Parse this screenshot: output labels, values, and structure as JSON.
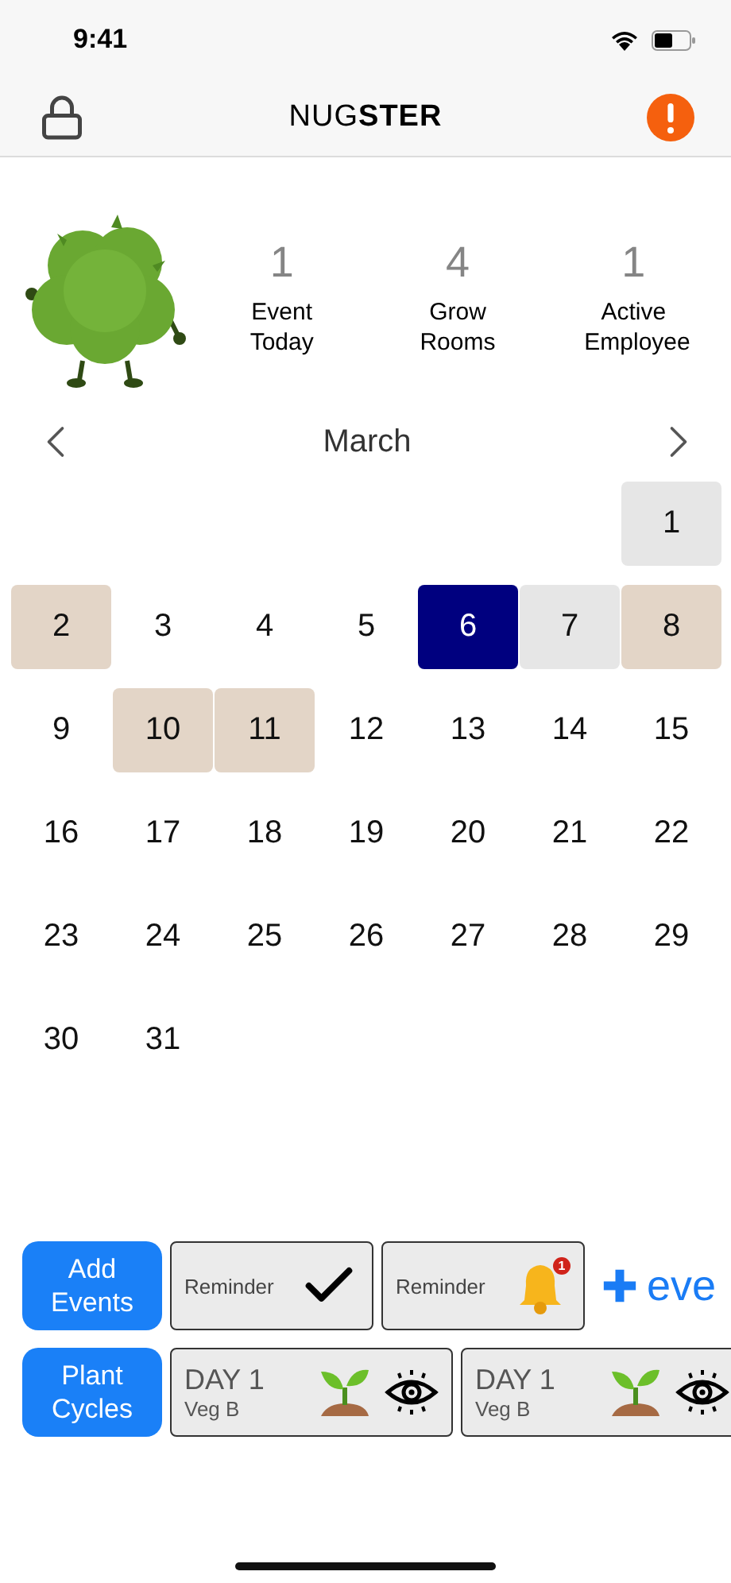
{
  "status_bar": {
    "time": "9:41"
  },
  "nav": {
    "title": "NUG**STER**"
  },
  "stats": [
    {
      "value": "1",
      "label": "Event Today"
    },
    {
      "value": "4",
      "label": "Grow Rooms"
    },
    {
      "value": "1",
      "label": "Active Employee"
    }
  ],
  "calendar": {
    "month": "March",
    "weeks": [
      [
        {
          "kind": "blank"
        },
        {
          "kind": "blank"
        },
        {
          "kind": "blank"
        },
        {
          "kind": "blank"
        },
        {
          "kind": "blank"
        },
        {
          "kind": "blank"
        },
        {
          "kind": "day",
          "label": "1",
          "selected": false,
          "has_event": false,
          "greyed": true
        }
      ],
      [
        {
          "kind": "day",
          "label": "2",
          "selected": false,
          "has_event": true,
          "greyed": false
        },
        {
          "kind": "day",
          "label": "3",
          "selected": false,
          "has_event": false,
          "greyed": false
        },
        {
          "kind": "day",
          "label": "4",
          "selected": false,
          "has_event": false,
          "greyed": false
        },
        {
          "kind": "day",
          "label": "5",
          "selected": false,
          "has_event": false,
          "greyed": false
        },
        {
          "kind": "day",
          "label": "6",
          "selected": true,
          "has_event": false,
          "greyed": false
        },
        {
          "kind": "day",
          "label": "7",
          "selected": false,
          "has_event": false,
          "greyed": true
        },
        {
          "kind": "day",
          "label": "8",
          "selected": false,
          "has_event": true,
          "greyed": false
        }
      ],
      [
        {
          "kind": "day",
          "label": "9",
          "selected": false,
          "has_event": false,
          "greyed": false
        },
        {
          "kind": "day",
          "label": "10",
          "selected": false,
          "has_event": true,
          "greyed": false
        },
        {
          "kind": "day",
          "label": "11",
          "selected": false,
          "has_event": true,
          "greyed": false
        },
        {
          "kind": "day",
          "label": "12",
          "selected": false,
          "has_event": false,
          "greyed": false
        },
        {
          "kind": "day",
          "label": "13",
          "selected": false,
          "has_event": false,
          "greyed": false
        },
        {
          "kind": "day",
          "label": "14",
          "selected": false,
          "has_event": false,
          "greyed": false
        },
        {
          "kind": "day",
          "label": "15",
          "selected": false,
          "has_event": false,
          "greyed": false
        }
      ],
      [
        {
          "kind": "day",
          "label": "16",
          "selected": false,
          "has_event": false,
          "greyed": false
        },
        {
          "kind": "day",
          "label": "17",
          "selected": false,
          "has_event": false,
          "greyed": false
        },
        {
          "kind": "day",
          "label": "18",
          "selected": false,
          "has_event": false,
          "greyed": false
        },
        {
          "kind": "day",
          "label": "19",
          "selected": false,
          "has_event": false,
          "greyed": false
        },
        {
          "kind": "day",
          "label": "20",
          "selected": false,
          "has_event": false,
          "greyed": false
        },
        {
          "kind": "day",
          "label": "21",
          "selected": false,
          "has_event": false,
          "greyed": false
        },
        {
          "kind": "day",
          "label": "22",
          "selected": false,
          "has_event": false,
          "greyed": false
        }
      ],
      [
        {
          "kind": "day",
          "label": "23",
          "selected": false,
          "has_event": false,
          "greyed": false
        },
        {
          "kind": "day",
          "label": "24",
          "selected": false,
          "has_event": false,
          "greyed": false
        },
        {
          "kind": "day",
          "label": "25",
          "selected": false,
          "has_event": false,
          "greyed": false
        },
        {
          "kind": "day",
          "label": "26",
          "selected": false,
          "has_event": false,
          "greyed": false
        },
        {
          "kind": "day",
          "label": "27",
          "selected": false,
          "has_event": false,
          "greyed": false
        },
        {
          "kind": "day",
          "label": "28",
          "selected": false,
          "has_event": false,
          "greyed": false
        },
        {
          "kind": "day",
          "label": "29",
          "selected": false,
          "has_event": false,
          "greyed": false
        }
      ],
      [
        {
          "kind": "day",
          "label": "30",
          "selected": false,
          "has_event": false,
          "greyed": false
        },
        {
          "kind": "day",
          "label": "31",
          "selected": false,
          "has_event": false,
          "greyed": false
        }
      ]
    ]
  },
  "events_row": {
    "button": "Add Events",
    "cards": [
      {
        "label": "Reminder",
        "kind": "done"
      },
      {
        "label": "Reminder",
        "kind": "alert",
        "badge": "1"
      }
    ],
    "add_link": "eve"
  },
  "cycles_row": {
    "button": "Plant Cycles",
    "cards": [
      {
        "day": "DAY 1",
        "room": "Veg B"
      },
      {
        "day": "DAY 1",
        "room": "Veg B"
      }
    ]
  }
}
